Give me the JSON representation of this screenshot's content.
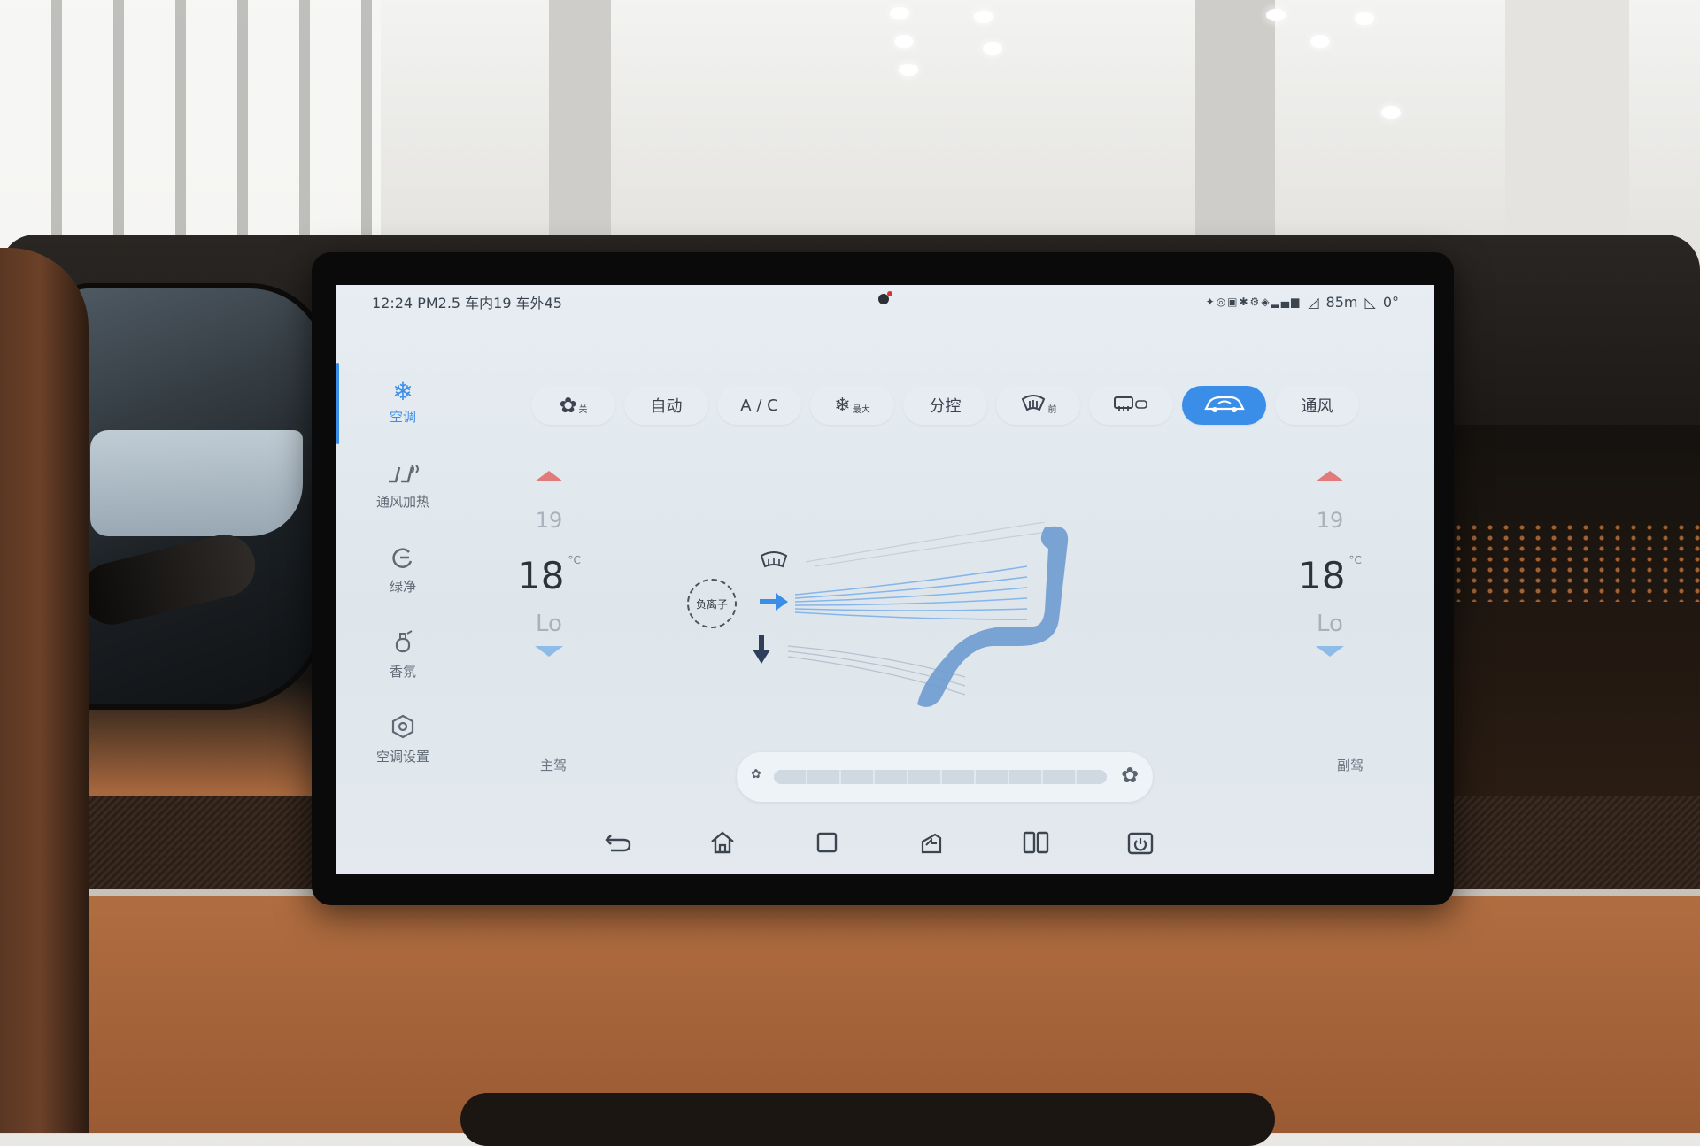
{
  "status_bar": {
    "left_text": "12:24 PM2.5 车内19 车外45",
    "right_text": "85m",
    "right_extra": "0°"
  },
  "sidebar": {
    "items": [
      {
        "label": "空调",
        "icon": "snowflake-icon",
        "active": true
      },
      {
        "label": "通风加热",
        "icon": "seat-heat-icon",
        "active": false
      },
      {
        "label": "绿净",
        "icon": "air-purify-icon",
        "active": false
      },
      {
        "label": "香氛",
        "icon": "fragrance-icon",
        "active": false
      },
      {
        "label": "空调设置",
        "icon": "settings-icon",
        "active": false
      }
    ]
  },
  "top_buttons": [
    {
      "label": "",
      "sub": "关",
      "icon": "fan-icon",
      "active": false
    },
    {
      "label": "自动",
      "sub": "",
      "icon": "",
      "active": false
    },
    {
      "label": "A / C",
      "sub": "",
      "icon": "",
      "active": false
    },
    {
      "label": "",
      "sub": "最大",
      "icon": "max-cool-icon",
      "active": false
    },
    {
      "label": "分控",
      "sub": "",
      "icon": "",
      "active": false
    },
    {
      "label": "",
      "sub": "前",
      "icon": "front-defrost-icon",
      "active": false
    },
    {
      "label": "",
      "sub": "",
      "icon": "rear-defrost-icon",
      "active": false
    },
    {
      "label": "",
      "sub": "",
      "icon": "recirculation-icon",
      "active": true
    },
    {
      "label": "通风",
      "sub": "",
      "icon": "",
      "active": false
    }
  ],
  "driver": {
    "temp_upper": "19",
    "temp_current": "18",
    "unit": "°C",
    "temp_lower": "Lo",
    "label": "主驾"
  },
  "passenger": {
    "temp_upper": "19",
    "temp_current": "18",
    "unit": "°C",
    "temp_lower": "Lo",
    "label": "副驾"
  },
  "center": {
    "anion_label": "负离子"
  },
  "fan_speed": {
    "level": 0
  },
  "nav_bar": [
    "back-icon",
    "home-icon",
    "recent-apps-icon",
    "driving-mode-icon",
    "split-screen-icon",
    "power-icon"
  ],
  "colors": {
    "accent": "#3b8ee8",
    "heat": "#e2797b",
    "cool": "#8fbbe8"
  }
}
